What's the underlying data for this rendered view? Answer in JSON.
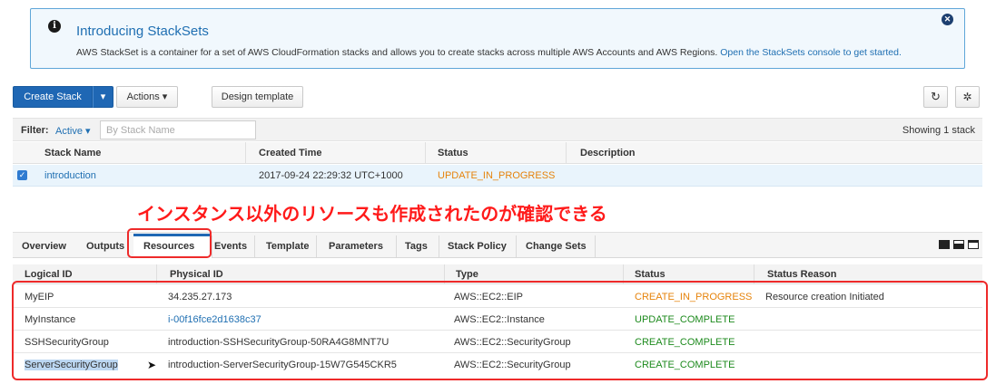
{
  "banner": {
    "title": "Introducing StackSets",
    "text": "AWS StackSet is a container for a set of AWS CloudFormation stacks and allows you to create stacks across multiple AWS Accounts and AWS Regions.",
    "link": "Open the StackSets console to get started."
  },
  "toolbar": {
    "create_stack": "Create Stack",
    "actions": "Actions",
    "design_template": "Design template"
  },
  "filter": {
    "label": "Filter:",
    "active": "Active",
    "placeholder": "By Stack Name",
    "showing": "Showing 1 stack"
  },
  "stacks": {
    "headers": [
      "Stack Name",
      "Created Time",
      "Status",
      "Description"
    ],
    "rows": [
      {
        "name": "introduction",
        "created": "2017-09-24 22:29:32 UTC+1000",
        "status": "UPDATE_IN_PROGRESS",
        "description": ""
      }
    ]
  },
  "annotation": "インスタンス以外のリソースも作成されたのが確認できる",
  "tabs": [
    "Overview",
    "Outputs",
    "Resources",
    "Events",
    "Template",
    "Parameters",
    "Tags",
    "Stack Policy",
    "Change Sets"
  ],
  "active_tab": "Resources",
  "resources": {
    "headers": [
      "Logical ID",
      "Physical ID",
      "Type",
      "Status",
      "Status Reason"
    ],
    "rows": [
      {
        "logical": "MyEIP",
        "physical": "34.235.27.173",
        "type": "AWS::EC2::EIP",
        "status": "CREATE_IN_PROGRESS",
        "reason": "Resource creation Initiated"
      },
      {
        "logical": "MyInstance",
        "physical": "i-00f16fce2d1638c37",
        "type": "AWS::EC2::Instance",
        "status": "UPDATE_COMPLETE",
        "reason": ""
      },
      {
        "logical": "SSHSecurityGroup",
        "physical": "introduction-SSHSecurityGroup-50RA4G8MNT7U",
        "type": "AWS::EC2::SecurityGroup",
        "status": "CREATE_COMPLETE",
        "reason": ""
      },
      {
        "logical": "ServerSecurityGroup",
        "physical": "introduction-ServerSecurityGroup-15W7G545CKR5",
        "type": "AWS::EC2::SecurityGroup",
        "status": "CREATE_COMPLETE",
        "reason": ""
      }
    ]
  },
  "colors": {
    "accent": "#1f67b4",
    "in_progress": "#e6830b",
    "complete": "#1d8a1d",
    "highlight": "#ee2a2a"
  }
}
